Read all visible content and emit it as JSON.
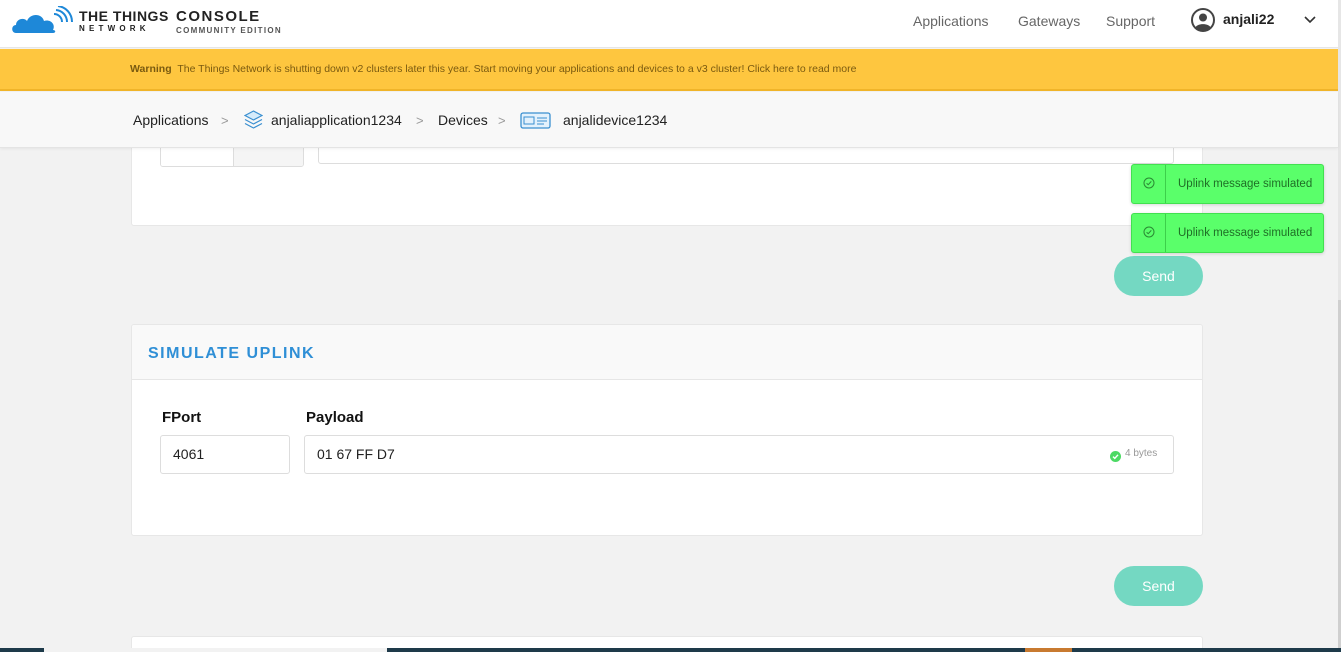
{
  "header": {
    "brand": "THE THINGS",
    "brand_sub": "NETWORK",
    "console": "CONSOLE",
    "console_sub": "COMMUNITY EDITION",
    "nav": {
      "applications": "Applications",
      "gateways": "Gateways",
      "support": "Support"
    },
    "user": "anjali22"
  },
  "warning": {
    "label": "Warning",
    "text": "The Things Network is shutting down v2 clusters later this year. Start moving your applications and devices to a v3 cluster! Click here to read more"
  },
  "breadcrumb": {
    "applications": "Applications",
    "application": "anjaliapplication1234",
    "devices": "Devices",
    "device": "anjalidevice1234",
    "separator": ">"
  },
  "top_panel": {
    "send_label": "Send"
  },
  "simulate_uplink": {
    "title": "SIMULATE UPLINK",
    "fport_label": "FPort",
    "fport_value": "4061",
    "payload_label": "Payload",
    "payload_value": "01  67  FF  D7",
    "payload_size": "4 bytes",
    "send_label": "Send"
  },
  "toasts": [
    {
      "text": "Uplink message simulated"
    },
    {
      "text": "Uplink message simulated"
    }
  ],
  "colors": {
    "accent": "#2f8fd6",
    "warning": "#fec63f",
    "send_button": "#74d8c2",
    "toast": "#5aff6a"
  }
}
